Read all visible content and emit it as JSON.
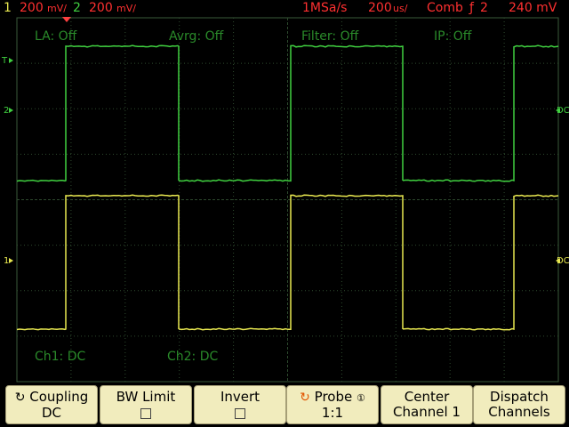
{
  "status_bar": {
    "ch1_index": "1",
    "ch1_scale": "200",
    "ch1_unit": "mV/",
    "ch2_index": "2",
    "ch2_scale": "200",
    "ch2_unit": "mV/",
    "sample_rate": "1MSa/s",
    "timebase_value": "200",
    "timebase_unit": "us/",
    "trigger_mode": "Comb",
    "trigger_symbol": "ƒ",
    "trigger_channel": "2",
    "trigger_level": "240 mV"
  },
  "overlays": {
    "la": "LA: Off",
    "avrg": "Avrg: Off",
    "filter": "Filter: Off",
    "ip": "IP: Off",
    "ch1_coupling": "Ch1: DC",
    "ch2_coupling": "Ch2: DC"
  },
  "markers": {
    "t_marker": "T",
    "ch2_marker": "2",
    "ch1_marker": "1",
    "right_dc_upper": "DC",
    "right_dc_lower": "DC"
  },
  "softkeys": [
    {
      "line1": "Coupling",
      "line2": "DC",
      "icon": "rotate-knob-icon"
    },
    {
      "line1": "BW Limit",
      "line2": "",
      "icon": "checkbox-icon"
    },
    {
      "line1": "Invert",
      "line2": "",
      "icon": "checkbox-icon"
    },
    {
      "line1": "Probe",
      "line2": "1:1",
      "icon": "rotate-knob-icon"
    },
    {
      "line1": "Center",
      "line2": "Channel 1",
      "icon": ""
    },
    {
      "line1": "Dispatch",
      "line2": "Channels",
      "icon": ""
    }
  ],
  "colors": {
    "background": "#000000",
    "grid": "#2e4a2e",
    "ch1_trace": "#e8e850",
    "ch2_trace": "#40d040",
    "status_text": "#ff3030",
    "softkey_bg": "#f1ecbd"
  },
  "chart_data": {
    "type": "line",
    "series": [
      {
        "channel": "2",
        "levels": [
          "low",
          "high",
          "low",
          "high",
          "low",
          "high"
        ]
      },
      {
        "channel": "1",
        "levels": [
          "low",
          "high",
          "low",
          "high",
          "low",
          "high"
        ]
      }
    ]
  }
}
